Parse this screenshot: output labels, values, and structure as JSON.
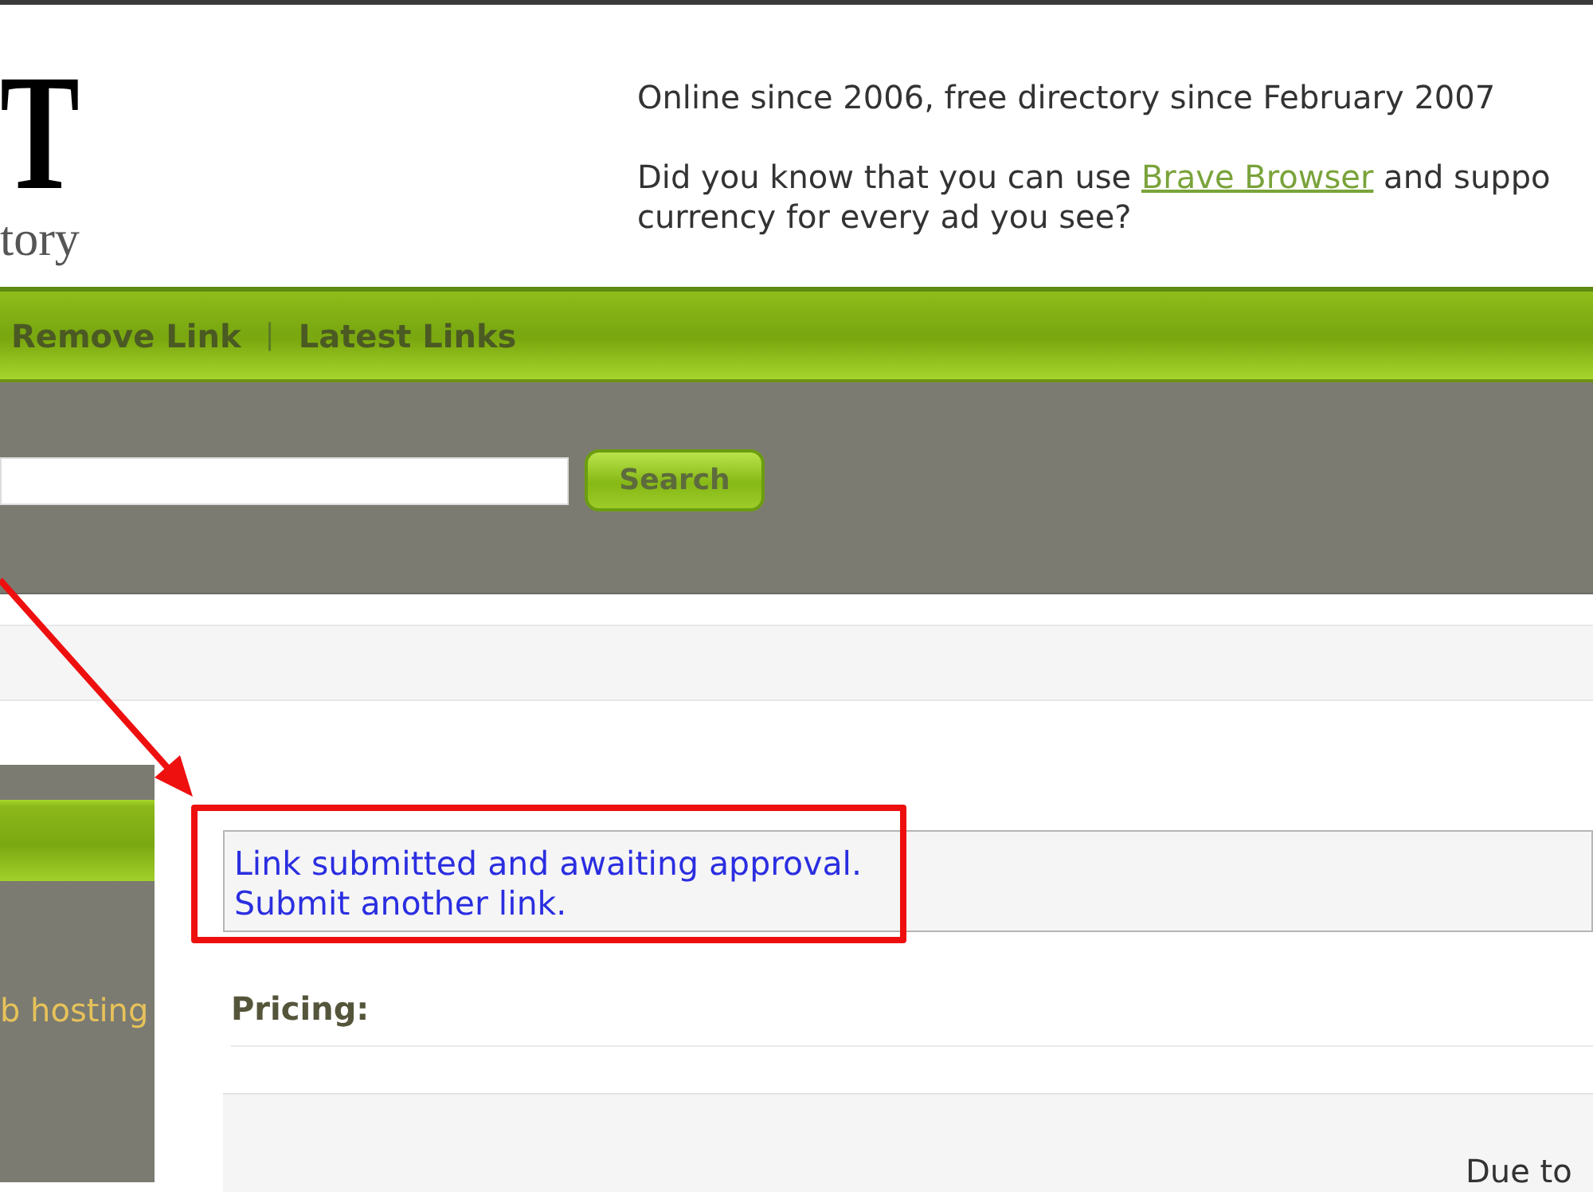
{
  "logo": {
    "letter": "T",
    "subtitle": "tory"
  },
  "header": {
    "tagline": "Online since 2006, free directory since February 2007",
    "tip": {
      "before": "Did you know that you can use ",
      "link": "Brave Browser",
      "after": " and suppo",
      "line_2": "currency for every ad you see?"
    }
  },
  "nav": {
    "items": [
      {
        "label": "Remove Link"
      },
      {
        "label": "Latest Links"
      }
    ],
    "separator": "|"
  },
  "search": {
    "button": "Search"
  },
  "sidebar": {
    "link": "b hosting"
  },
  "notice": {
    "status": "Link submitted and awaiting approval.",
    "link": "Submit another link."
  },
  "pricing": {
    "heading": "Pricing:",
    "text": "Due to"
  }
}
